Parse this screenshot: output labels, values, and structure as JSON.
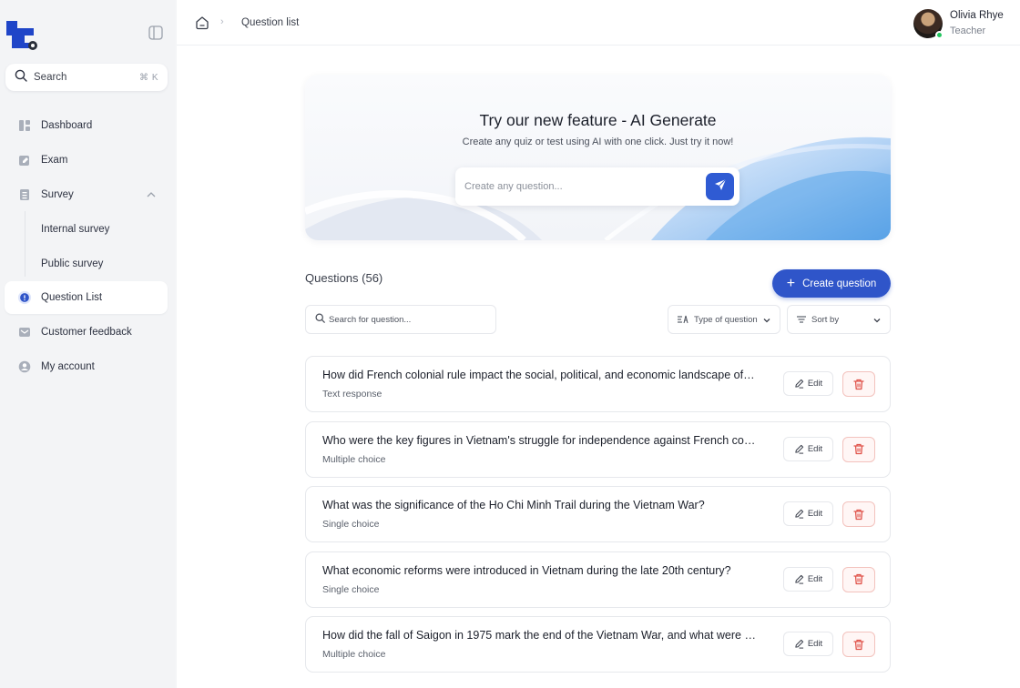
{
  "sidebar": {
    "search": {
      "label": "Search",
      "shortcut": "⌘ K"
    },
    "items": [
      {
        "label": "Dashboard",
        "icon": "dashboard-icon"
      },
      {
        "label": "Exam",
        "icon": "exam-icon"
      },
      {
        "label": "Survey",
        "icon": "survey-icon",
        "expanded": true
      },
      {
        "label": "Question List",
        "icon": "question-icon",
        "active": true
      },
      {
        "label": "Customer feedback",
        "icon": "feedback-icon"
      },
      {
        "label": "My account",
        "icon": "account-icon"
      }
    ],
    "survey_children": [
      {
        "label": "Internal survey"
      },
      {
        "label": "Public survey"
      }
    ]
  },
  "header": {
    "breadcrumb": [
      "Question list"
    ],
    "user": {
      "name": "Olivia Rhye",
      "role": "Teacher",
      "status": "online"
    }
  },
  "banner": {
    "title": "Try our new feature - AI Generate",
    "subtitle": "Create any quiz or test using AI with one click. Just try it now!",
    "input_placeholder": "Create any question..."
  },
  "questions": {
    "title": "Questions (56)",
    "create_label": "Create question",
    "search_placeholder": "Search for question...",
    "filter_type_label": "Type of question",
    "sort_label": "Sort by",
    "edit_label": "Edit",
    "items": [
      {
        "text": "How did French colonial rule impact the social, political, and economic landscape of Vietnam?",
        "type": "Text response"
      },
      {
        "text": "Who were the key figures in Vietnam's struggle for independence against French colonial rule?",
        "type": "Multiple choice"
      },
      {
        "text": "What was the significance of the Ho Chi Minh Trail during the Vietnam War?",
        "type": "Single choice"
      },
      {
        "text": "What economic reforms were introduced in Vietnam during the late 20th century?",
        "type": "Single choice"
      },
      {
        "text": "How did the fall of Saigon in 1975 mark the end of the Vietnam War, and what were its consequences?",
        "type": "Multiple choice"
      }
    ]
  },
  "colors": {
    "accent": "#2f55c9",
    "online": "#22c55e",
    "danger": "#e0534a"
  }
}
